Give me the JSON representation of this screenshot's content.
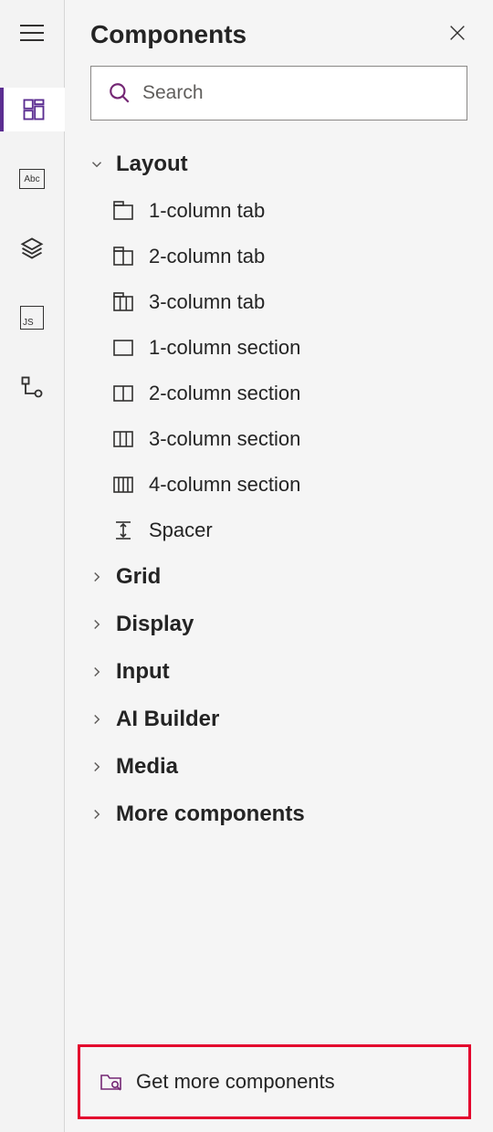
{
  "panel_title": "Components",
  "search": {
    "placeholder": "Search"
  },
  "groups": [
    {
      "key": "layout",
      "label": "Layout",
      "expanded": true
    },
    {
      "key": "grid",
      "label": "Grid",
      "expanded": false
    },
    {
      "key": "display",
      "label": "Display",
      "expanded": false
    },
    {
      "key": "input",
      "label": "Input",
      "expanded": false
    },
    {
      "key": "ai_builder",
      "label": "AI Builder",
      "expanded": false
    },
    {
      "key": "media",
      "label": "Media",
      "expanded": false
    },
    {
      "key": "more",
      "label": "More components",
      "expanded": false
    }
  ],
  "layout_items": [
    {
      "label": "1-column tab"
    },
    {
      "label": "2-column tab"
    },
    {
      "label": "3-column tab"
    },
    {
      "label": "1-column section"
    },
    {
      "label": "2-column section"
    },
    {
      "label": "3-column section"
    },
    {
      "label": "4-column section"
    },
    {
      "label": "Spacer"
    }
  ],
  "footer": {
    "get_more_label": "Get more components"
  },
  "sidebar_icons": {
    "abc_label": "Abc",
    "js_label": "JS"
  }
}
